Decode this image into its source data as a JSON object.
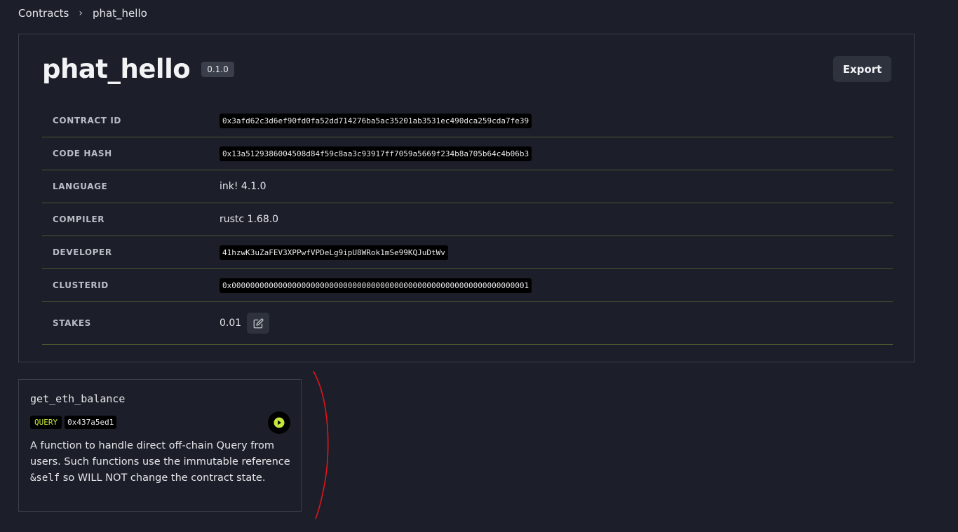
{
  "breadcrumb": {
    "root": "Contracts",
    "separator": "›",
    "current": "phat_hello"
  },
  "contract": {
    "name": "phat_hello",
    "version": "0.1.0",
    "export_label": "Export"
  },
  "info": {
    "contract_id": {
      "label": "CONTRACT ID",
      "value": "0x3afd62c3d6ef90fd0fa52dd714276ba5ac35201ab3531ec490dca259cda7fe39"
    },
    "code_hash": {
      "label": "CODE HASH",
      "value": "0x13a5129386004508d84f59c8aa3c93917ff7059a5669f234b8a705b64c4b06b3"
    },
    "language": {
      "label": "LANGUAGE",
      "value": "ink! 4.1.0"
    },
    "compiler": {
      "label": "COMPILER",
      "value": "rustc 1.68.0"
    },
    "developer": {
      "label": "DEVELOPER",
      "value": "41hzwK3uZaFEV3XPPwfVPDeLg9ipU8WRok1mSe99KQJuDtWv"
    },
    "clusterid": {
      "label": "CLUSTERID",
      "value": "0x0000000000000000000000000000000000000000000000000000000000000001"
    },
    "stakes": {
      "label": "STAKES",
      "value": "0.01"
    }
  },
  "method": {
    "name": "get_eth_balance",
    "type_badge": "QUERY",
    "selector": "0x437a5ed1",
    "desc_part1": "A function to handle direct off-chain Query from users. Such functions use the immutable reference ",
    "desc_code": "&self",
    "desc_part2": " so WILL NOT change the contract state."
  },
  "colors": {
    "background": "#1c1f2a",
    "query_accent": "#c5e63a",
    "row_divider": "#4b5630",
    "annotation": "#e0151b"
  },
  "icons": {
    "edit": "edit-icon",
    "run": "play-icon"
  }
}
